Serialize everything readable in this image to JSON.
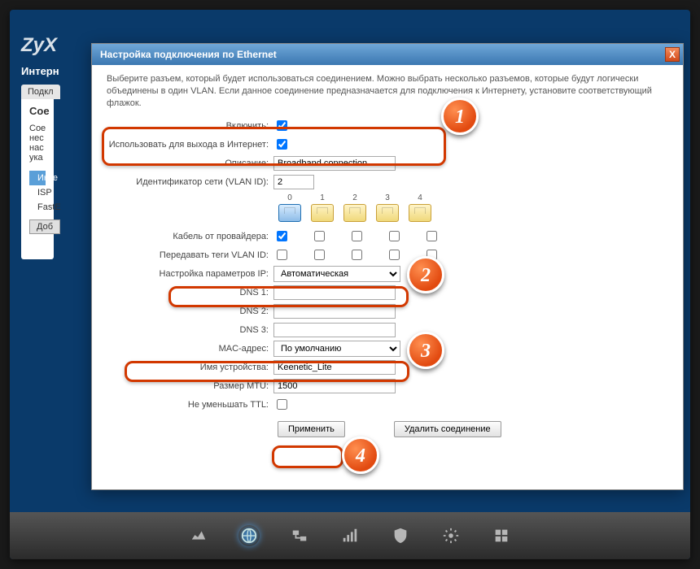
{
  "background": {
    "logo": "ZyX",
    "nav": "Интерн",
    "tab": "Подкл",
    "card_title": "Сое",
    "card_lines": [
      "Сое",
      "нес",
      "нас",
      "ука"
    ],
    "section": "Инте",
    "rows": [
      "ISP",
      "FastE"
    ],
    "add_btn": "Доб"
  },
  "modal": {
    "title": "Настройка подключения по Ethernet",
    "close": "X",
    "intro": "Выберите разъем, который будет использоваться соединением. Можно выбрать несколько разъемов, которые будут логически объединены в один VLAN. Если данное соединение предназначается для подключения к Интернету, установите соответствующий флажок.",
    "labels": {
      "enable": "Включить:",
      "use_internet": "Использовать для выхода в Интернет:",
      "description": "Описание:",
      "vlan_id": "Идентификатор сети (VLAN ID):",
      "provider_cable": "Кабель от провайдера:",
      "pass_vlan": "Передавать теги VLAN ID:",
      "ip_config": "Настройка параметров IP:",
      "dns1": "DNS 1:",
      "dns2": "DNS 2:",
      "dns3": "DNS 3:",
      "mac": "MAC-адрес:",
      "device_name": "Имя устройства:",
      "mtu": "Размер MTU:",
      "ttl": "Не уменьшать TTL:"
    },
    "values": {
      "enable": true,
      "use_internet": true,
      "description": "Broadband connection",
      "vlan_id": "2",
      "ports": [
        "0",
        "1",
        "2",
        "3",
        "4"
      ],
      "provider_cable": [
        true,
        false,
        false,
        false,
        false
      ],
      "pass_vlan": [
        false,
        false,
        false,
        false,
        false
      ],
      "ip_config_options": [
        "Автоматическая"
      ],
      "ip_config": "Автоматическая",
      "dns1": "",
      "dns2": "",
      "dns3": "",
      "mac_options": [
        "По умолчанию"
      ],
      "mac": "По умолчанию",
      "device_name": "Keenetic_Lite",
      "mtu": "1500",
      "ttl": false
    },
    "buttons": {
      "apply": "Применить",
      "delete": "Удалить соединение"
    }
  },
  "annotations": {
    "1": "1",
    "2": "2",
    "3": "3",
    "4": "4"
  },
  "bottombar": {
    "icons": [
      "monitor",
      "globe",
      "network",
      "signal",
      "shield",
      "gear",
      "apps"
    ]
  }
}
